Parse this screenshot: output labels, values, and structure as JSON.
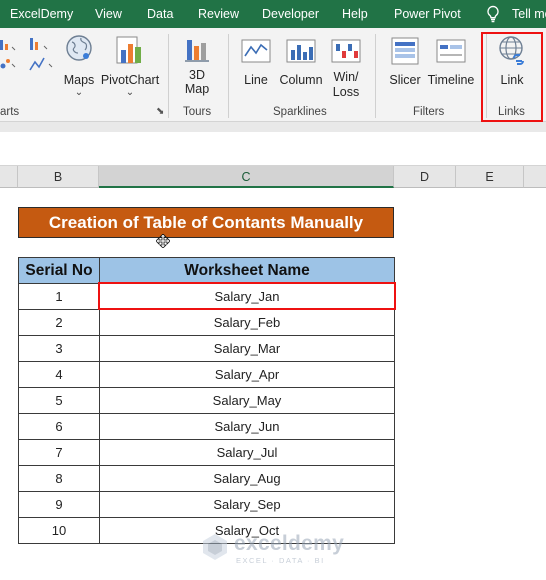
{
  "ribbon_tabs": [
    "ExcelDemy",
    "View",
    "Data",
    "Review",
    "Developer",
    "Help",
    "Power Pivot",
    "Tell me"
  ],
  "ribbon": {
    "charts_group_label": "arts",
    "buttons": {
      "maps": "Maps",
      "pivotchart": "PivotChart",
      "map3d_line1": "3D",
      "map3d_line2": "Map",
      "line": "Line",
      "column": "Column",
      "winloss_line1": "Win/",
      "winloss_line2": "Loss",
      "slicer": "Slicer",
      "timeline": "Timeline",
      "link": "Link"
    },
    "groups": {
      "tours": "Tours",
      "sparklines": "Sparklines",
      "filters": "Filters",
      "links": "Links"
    }
  },
  "column_headers": [
    "B",
    "C",
    "D",
    "E"
  ],
  "sheet": {
    "title": "Creation of Table of Contants Manually",
    "headers": [
      "Serial No",
      "Worksheet Name"
    ],
    "rows": [
      [
        "1",
        "Salary_Jan"
      ],
      [
        "2",
        "Salary_Feb"
      ],
      [
        "3",
        "Salary_Mar"
      ],
      [
        "4",
        "Salary_Apr"
      ],
      [
        "5",
        "Salary_May"
      ],
      [
        "6",
        "Salary_Jun"
      ],
      [
        "7",
        "Salary_Jul"
      ],
      [
        "8",
        "Salary_Aug"
      ],
      [
        "9",
        "Salary_Sep"
      ],
      [
        "10",
        "Salary_Oct"
      ]
    ]
  },
  "watermark": {
    "name": "exceldemy",
    "tagline": "EXCEL · DATA · BI"
  },
  "colors": {
    "ribbon_green": "#217346",
    "title_fill": "#c55a11",
    "header_fill": "#9dc3e6",
    "highlight_red": "#ee1111"
  }
}
